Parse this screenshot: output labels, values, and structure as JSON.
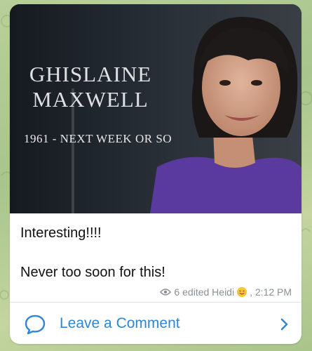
{
  "post": {
    "image": {
      "name_line1": "GHISLAINE",
      "name_line2": "MAXWELL",
      "dates": "1961 - NEXT WEEK OR SO"
    },
    "text_line1": "Interesting!!!!",
    "text_line2": "Never too soon for this!",
    "meta": {
      "views": "6",
      "author": "edited Heidi",
      "emoji": "smiling-face-emoji",
      "time": ", 2:12 PM"
    }
  },
  "comment": {
    "label": "Leave a Comment",
    "icon": "speech-bubble-icon",
    "arrow": "chevron-right-icon"
  },
  "colors": {
    "accent": "#2f86d6",
    "meta": "#8a8f96",
    "bubble": "#ffffff"
  }
}
